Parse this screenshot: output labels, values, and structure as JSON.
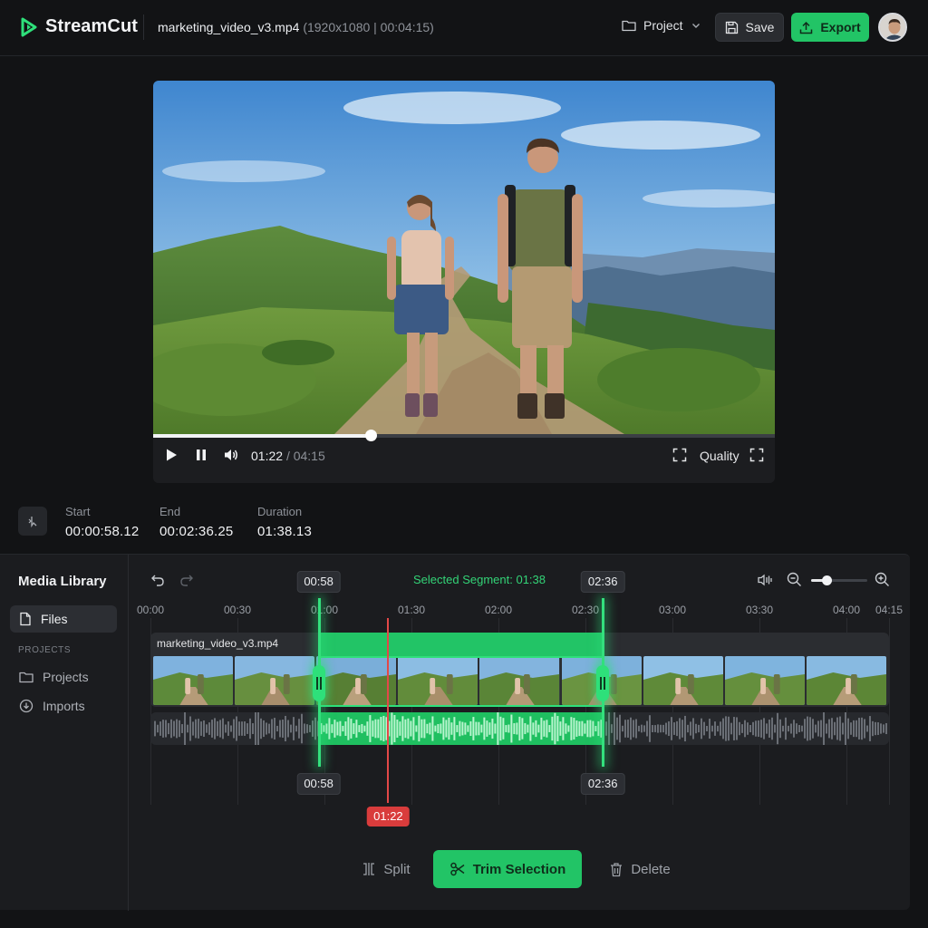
{
  "app": {
    "name": "StreamCut"
  },
  "file": {
    "name": "marketing_video_v3.mp4",
    "meta": "(1920x1080 | 00:04:15)"
  },
  "header": {
    "project_label": "Project",
    "save_label": "Save",
    "export_label": "Export"
  },
  "player": {
    "current_time": "01:22",
    "duration": "/ 04:15",
    "progress": 0.35,
    "quality_label": "Quality"
  },
  "segment": {
    "start_label": "Start",
    "start_value": "00:00:58.12",
    "end_label": "End",
    "end_value": "00:02:36.25",
    "duration_label": "Duration",
    "duration_value": "01:38.13"
  },
  "library": {
    "title": "Media Library",
    "files_label": "Files",
    "section_label": "PROJECTS",
    "projects_label": "Projects",
    "imports_label": "Imports"
  },
  "timeline": {
    "selected_text": "Selected Segment: 01:38",
    "ruler": [
      "00:00",
      "00:30",
      "01:00",
      "01:30",
      "02:00",
      "02:30",
      "03:00",
      "03:30",
      "04:00",
      "04:15"
    ],
    "clip_name": "marketing_video_v3.mp4",
    "sel_start_tag": "00:58",
    "sel_end_tag": "02:36",
    "playhead_tag": "01:22",
    "zoom_level": 0.28,
    "selection_start_s": 58,
    "selection_end_s": 156,
    "playhead_s": 82,
    "total_s": 255
  },
  "actions": {
    "split_label": "Split",
    "trim_label": "Trim Selection",
    "delete_label": "Delete"
  },
  "colors": {
    "accent": "#22c466",
    "playhead": "#e34848",
    "background": "#121315"
  }
}
